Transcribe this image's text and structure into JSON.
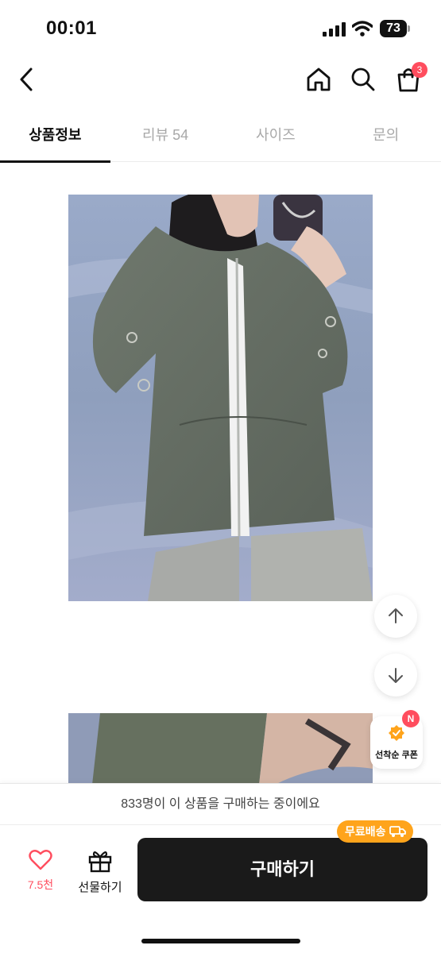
{
  "status_bar": {
    "time": "00:01",
    "battery": "73"
  },
  "nav": {
    "cart_count": "3"
  },
  "tabs": [
    {
      "label": "상품정보",
      "active": true
    },
    {
      "label": "리뷰 54",
      "active": false
    },
    {
      "label": "사이즈",
      "active": false
    },
    {
      "label": "문의",
      "active": false
    }
  ],
  "coupon": {
    "badge": "N",
    "label": "선착순 쿠폰"
  },
  "bottom": {
    "buyers_notice": "833명이 이 상품을 구매하는 중이에요",
    "like_count": "7.5천",
    "gift_label": "선물하기",
    "buy_label": "구매하기",
    "free_shipping": "무료배송"
  },
  "colors": {
    "accent": "#ff4d5e",
    "buy_button": "#1a1a1a",
    "free_shipping": "#ffa41b"
  }
}
